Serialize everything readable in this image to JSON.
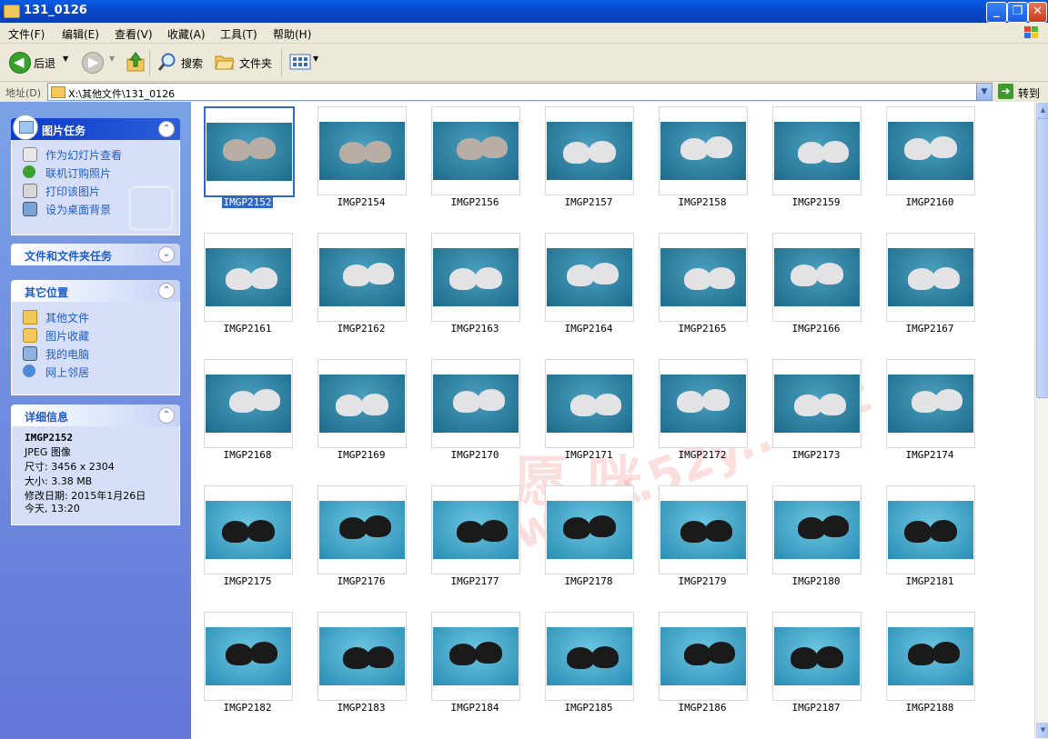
{
  "window": {
    "title": "131_0126"
  },
  "menu": [
    "文件(F)",
    "编辑(E)",
    "查看(V)",
    "收藏(A)",
    "工具(T)",
    "帮助(H)"
  ],
  "toolbar": {
    "back": "后退",
    "search": "搜索",
    "folders": "文件夹"
  },
  "address": {
    "label": "地址(D)",
    "path": "X:\\其他文件\\131_0126",
    "go": "转到"
  },
  "tasks": {
    "picture_tasks": {
      "title": "图片任务",
      "items": [
        "作为幻灯片查看",
        "联机订购照片",
        "打印该图片",
        "设为桌面背景"
      ]
    },
    "file_tasks": {
      "title": "文件和文件夹任务"
    },
    "other_places": {
      "title": "其它位置",
      "items": [
        "其他文件",
        "图片收藏",
        "我的电脑",
        "网上邻居"
      ]
    },
    "details": {
      "title": "详细信息",
      "name": "IMGP2152",
      "type": "JPEG 图像",
      "size_dim": "尺寸: 3456 x 2304",
      "filesize": "大小: 3.38 MB",
      "modified": "修改日期: 2015年1月26日",
      "modified2": "今天, 13:20"
    }
  },
  "files": [
    "IMGP2152",
    "IMGP2154",
    "IMGP2156",
    "IMGP2157",
    "IMGP2158",
    "IMGP2159",
    "IMGP2160",
    "IMGP2161",
    "IMGP2162",
    "IMGP2163",
    "IMGP2164",
    "IMGP2165",
    "IMGP2166",
    "IMGP2167",
    "IMGP2168",
    "IMGP2169",
    "IMGP2170",
    "IMGP2171",
    "IMGP2172",
    "IMGP2173",
    "IMGP2174",
    "IMGP2175",
    "IMGP2176",
    "IMGP2177",
    "IMGP2178",
    "IMGP2179",
    "IMGP2180",
    "IMGP2181",
    "IMGP2182",
    "IMGP2183",
    "IMGP2184",
    "IMGP2185",
    "IMGP2186",
    "IMGP2187",
    "IMGP2188"
  ],
  "selected_file": "IMGP2152",
  "watermark": {
    "chars": "愿 咪",
    "url": "www.52y...net"
  },
  "colors": {
    "selection": "#316ac5",
    "titlebar": "#0a5ce4",
    "taskpane": "#6f8fdf"
  }
}
